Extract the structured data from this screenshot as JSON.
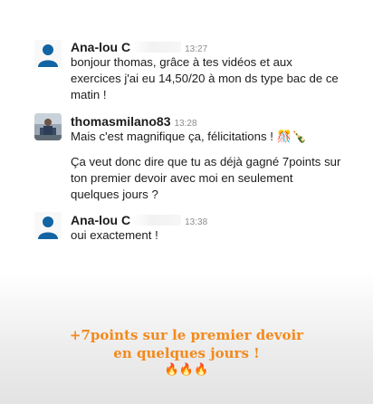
{
  "messages": [
    {
      "author": "Ana-lou C",
      "time": "13:27",
      "lines": [
        "bonjour thomas, grâce à tes vidéos et aux exercices j'ai eu 14,50/20 à mon ds type bac de ce matin !"
      ]
    },
    {
      "author": "thomasmilano83",
      "time": "13:28",
      "lines": [
        "Mais c'est magnifique ça, félicitations ! 🎊🍾",
        "Ça veut donc dire que tu as déjà gagné 7points sur ton premier devoir avec moi en seulement quelques jours ?"
      ]
    },
    {
      "author": "Ana-lou C",
      "time": "13:38",
      "lines": [
        "oui exactement !"
      ]
    }
  ],
  "caption": {
    "line1": "+7points sur le premier devoir",
    "line2": "en quelques jours !",
    "emoji": "🔥🔥🔥"
  },
  "colors": {
    "caption": "#f28a1e",
    "avatar_default": "#1264a3"
  },
  "icons": [
    "person-avatar-icon",
    "user-photo-avatar",
    "confetti-icon",
    "champagne-icon",
    "fire-icon"
  ]
}
